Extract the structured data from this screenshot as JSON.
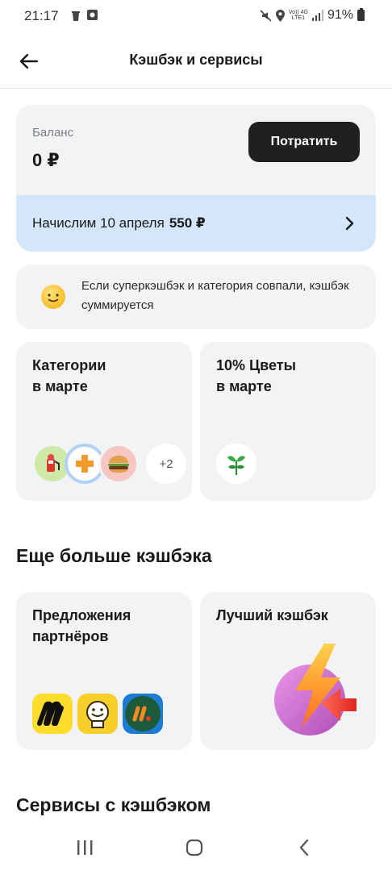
{
  "status_bar": {
    "time": "21:17",
    "battery": "91%",
    "net_top": "Vo)) 4G",
    "net_bottom": "LTE1"
  },
  "header": {
    "title": "Кэшбэк и сервисы",
    "back_icon": "arrow-left-icon"
  },
  "balance": {
    "label": "Баланс",
    "value": "0 ₽",
    "spend_button": "Потратить",
    "accrual_text": "Начислим 10 апреля",
    "accrual_amount": "550 ₽"
  },
  "info": {
    "text": "Если суперкэшбэк и категория совпали, кэшбэк суммируется",
    "icon": "smiley-icon"
  },
  "categories_tile": {
    "title": "Категории\nв марте",
    "more_count": "+2",
    "icons": [
      "gas-station-icon",
      "pharmacy-cross-icon",
      "burger-icon"
    ]
  },
  "flowers_tile": {
    "title": "10% Цветы\nв марте",
    "icon": "plant-icon"
  },
  "more_cashback": {
    "section_title": "Еще больше кэшбэка",
    "partners_tile_title": "Предложения\nпартнёров",
    "best_tile_title": "Лучший кэшбэк",
    "partner_logos": [
      "yandex-market-icon",
      "smiling-bag-icon",
      "vkusno-i-tochka-icon"
    ]
  },
  "services": {
    "section_title": "Сервисы с кэшбэком"
  },
  "colors": {
    "card_bg": "#f2f3f5",
    "accrual_bg": "#d4e6fb",
    "dark_button": "#1f2022"
  }
}
